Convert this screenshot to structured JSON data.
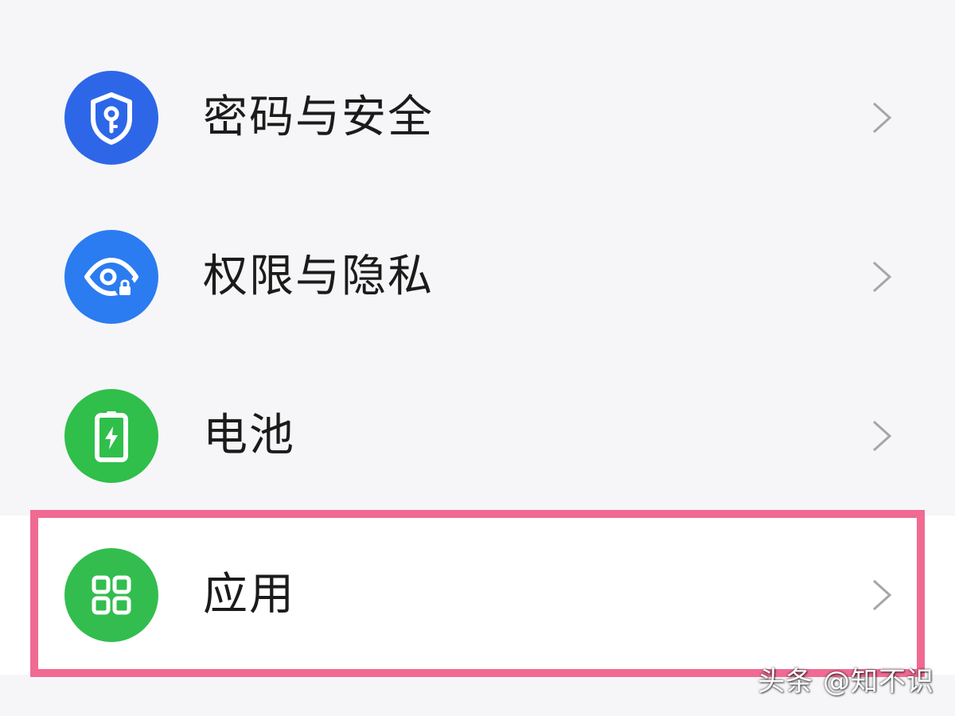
{
  "colors": {
    "security_icon_bg": "#2d67e8",
    "privacy_icon_bg": "#2b7cf0",
    "battery_icon_bg": "#2fbf4a",
    "apps_icon_bg": "#33bd4f",
    "highlight": "#f06a92",
    "chevron": "#a5a5aa"
  },
  "settings": {
    "items": [
      {
        "label": "密码与安全",
        "icon": "shield-key-icon"
      },
      {
        "label": "权限与隐私",
        "icon": "eye-lock-icon"
      },
      {
        "label": "电池",
        "icon": "battery-icon"
      },
      {
        "label": "应用",
        "icon": "app-grid-icon"
      }
    ]
  },
  "watermark": {
    "text": "头条 @知不识"
  }
}
